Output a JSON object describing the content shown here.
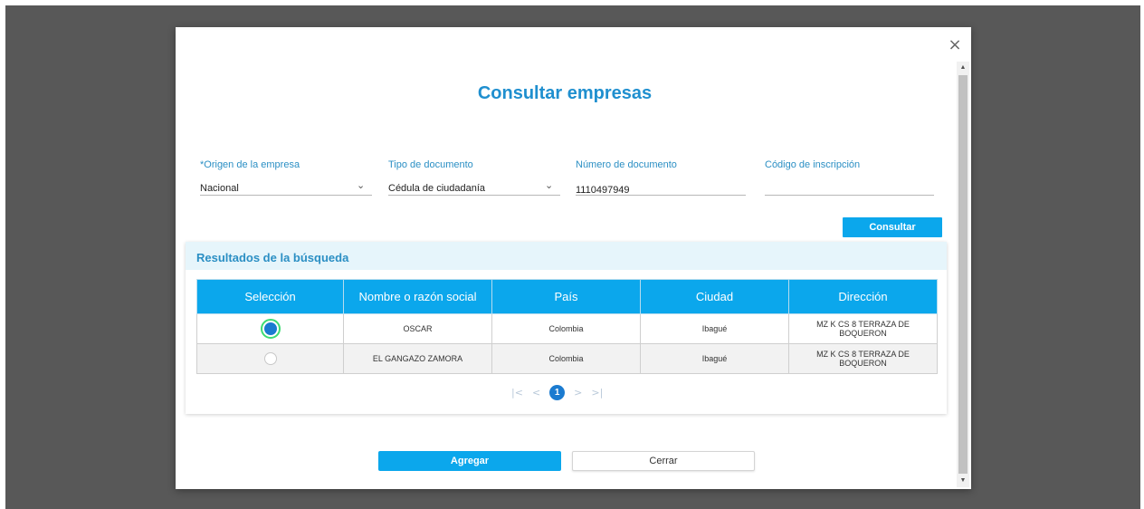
{
  "modal": {
    "title": "Consultar empresas",
    "close_glyph": "×"
  },
  "form": {
    "origen": {
      "label": "*Origen de la empresa",
      "value": "Nacional",
      "icon": "chevron-down-icon"
    },
    "tipo_documento": {
      "label": "Tipo de documento",
      "value": "Cédula de ciudadanía",
      "icon": "chevron-down-icon"
    },
    "numero_documento": {
      "label": "Número de documento",
      "value": "1110497949"
    },
    "codigo_inscripcion": {
      "label": "Código de inscripción",
      "value": ""
    },
    "chevron_glyph": "⌄",
    "consultar_label": "Consultar"
  },
  "results": {
    "title": "Resultados de la búsqueda",
    "columns": [
      "Selección",
      "Nombre o razón social",
      "País",
      "Ciudad",
      "Dirección"
    ],
    "rows": [
      {
        "selected": true,
        "nombre": "OSCAR",
        "pais": "Colombia",
        "ciudad": "Ibagué",
        "direccion": "MZ K CS 8 TERRAZA DE BOQUERON"
      },
      {
        "selected": false,
        "nombre": "EL GANGAZO ZAMORA",
        "pais": "Colombia",
        "ciudad": "Ibagué",
        "direccion": "MZ K CS 8 TERRAZA DE BOQUERON"
      }
    ],
    "pager": {
      "first": "|<",
      "prev": "<",
      "current_page": "1",
      "next": ">",
      "last": ">|"
    }
  },
  "footer": {
    "agregar_label": "Agregar",
    "cerrar_label": "Cerrar"
  },
  "colors": {
    "accent": "#0ba7ec",
    "title": "#1f8fcf",
    "backdrop": "#585858",
    "selected_radio": "#1b7bd0",
    "highlight": "#3ddc72"
  }
}
